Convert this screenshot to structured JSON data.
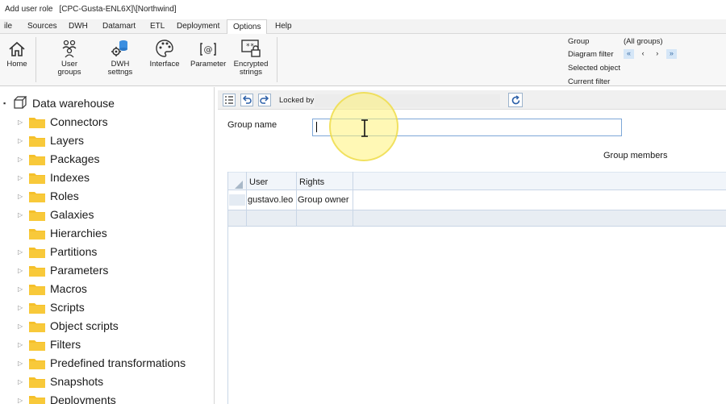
{
  "window": {
    "title": "Add user role",
    "context": "[CPC-Gusta-ENL6X]\\[Northwind]"
  },
  "menu": {
    "tabs": [
      "ile",
      "Sources",
      "DWH",
      "Datamart",
      "ETL",
      "Deployment",
      "Options",
      "Help"
    ],
    "active": "Options"
  },
  "ribbon": {
    "home": "Home",
    "user_groups_1": "User",
    "user_groups_2": "groups",
    "dwh_settings_1": "DWH",
    "dwh_settings_2": "settngs",
    "interface": "Interface",
    "parameter": "Parameter",
    "encrypted_1": "Encrypted",
    "encrypted_2": "strings",
    "group_label": "Group",
    "group_value": "(All groups)",
    "diagram_filter": "Diagram filter",
    "selected_object": "Selected object",
    "current_filter": "Current filter",
    "nav": [
      "«",
      "‹",
      "›",
      "»"
    ]
  },
  "tree": {
    "root": "Data warehouse",
    "items": [
      {
        "label": "Connectors",
        "expandable": true
      },
      {
        "label": "Layers",
        "expandable": true
      },
      {
        "label": "Packages",
        "expandable": true
      },
      {
        "label": "Indexes",
        "expandable": true
      },
      {
        "label": "Roles",
        "expandable": true
      },
      {
        "label": "Galaxies",
        "expandable": true
      },
      {
        "label": "Hierarchies",
        "expandable": false
      },
      {
        "label": "Partitions",
        "expandable": true
      },
      {
        "label": "Parameters",
        "expandable": true
      },
      {
        "label": "Macros",
        "expandable": true
      },
      {
        "label": "Scripts",
        "expandable": true
      },
      {
        "label": "Object scripts",
        "expandable": true
      },
      {
        "label": "Filters",
        "expandable": true
      },
      {
        "label": "Predefined transformations",
        "expandable": true
      },
      {
        "label": "Snapshots",
        "expandable": true
      },
      {
        "label": "Deployments",
        "expandable": true
      }
    ]
  },
  "form": {
    "locked_by_label": "Locked by",
    "locked_by_value": "",
    "group_name_label": "Group name",
    "group_name_value": "",
    "members_title": "Group members"
  },
  "grid": {
    "columns": [
      "User",
      "Rights"
    ],
    "rows": [
      {
        "user": "gustavo.leo",
        "rights": "Group owner"
      }
    ]
  },
  "colors": {
    "folder": "#f5c02a",
    "accent_border": "#7ea7d8",
    "cursor_highlight": "#fff378"
  }
}
